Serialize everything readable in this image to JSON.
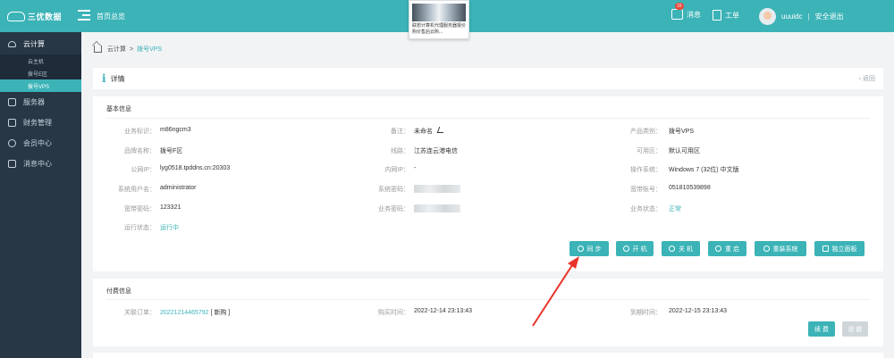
{
  "topbar": {
    "logo_text": "三优数据",
    "home_label": "首页总览",
    "ad_text": "联想计算机代理服务器报价购价售后云购...",
    "messages_label": "消息",
    "messages_count": "15",
    "ticket_label": "工单",
    "username": "uuuidc",
    "separator": "|",
    "logout_label": "安全退出",
    "color_primary": "#3bb3b7"
  },
  "sidebar": {
    "cloud": "云计算",
    "sub": [
      "云主机",
      "拨号E区",
      "拨号VPS"
    ],
    "items": [
      "服务器",
      "财务管理",
      "会员中心",
      "消息中心"
    ]
  },
  "breadcrumb": {
    "root": "云计算",
    "sep": ">",
    "current": "拨号VPS"
  },
  "detail": {
    "icon": "i",
    "title": "详情",
    "back": "‹ 返回"
  },
  "basic": {
    "title": "基本信息",
    "rows": [
      [
        [
          "业务标识：",
          "m86ngcm3"
        ],
        [
          "备注：",
          "未命名"
        ],
        [
          "产品类别：",
          "拨号VPS"
        ]
      ],
      [
        [
          "品牌名称：",
          "拨号F区"
        ],
        [
          "线路：",
          "江苏连云港电信"
        ],
        [
          "可用区：",
          "默认可用区"
        ]
      ],
      [
        [
          "公网IP：",
          "lyg0518.tpddns.cn:20303"
        ],
        [
          "内网IP：",
          "-"
        ],
        [
          "操作系统：",
          "Windows 7 (32位) 中文版"
        ]
      ],
      [
        [
          "系统用户名：",
          "administrator"
        ],
        [
          "系统密码：",
          ""
        ],
        [
          "宽带账号：",
          "051810539898"
        ]
      ],
      [
        [
          "宽带密码：",
          "123321"
        ],
        [
          "业务密码：",
          ""
        ],
        [
          "业务状态：",
          "正常"
        ]
      ],
      [
        [
          "运行状态：",
          "运行中"
        ]
      ]
    ],
    "buttons": [
      "同 步",
      "开 机",
      "关 机",
      "重 启",
      "重装系统",
      "独立面板"
    ]
  },
  "pay": {
    "title": "付费信息",
    "order_label": "关联订单：",
    "order_id": "20221214465792",
    "order_tag": "[ 新购 ]",
    "buy_label": "购买时间：",
    "buy_time": "2022-12-14 23:13:43",
    "expire_label": "到期时间：",
    "expire_time": "2022-12-15 23:13:43",
    "renew": "续 费",
    "refund": "退 款"
  }
}
